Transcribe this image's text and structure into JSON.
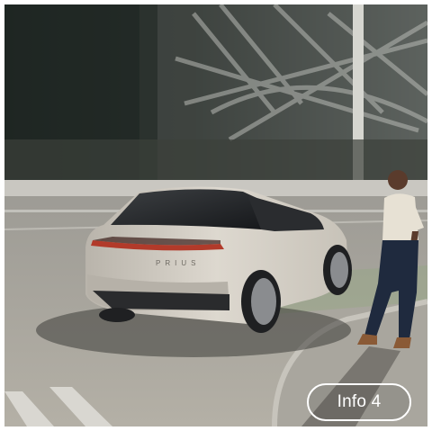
{
  "photo": {
    "subject": "vehicle-photo",
    "car_badge_text": "PRIUS"
  },
  "info_button": {
    "label": "Info 4"
  },
  "colors": {
    "button_border": "#ffffff",
    "button_text": "#ffffff",
    "car_body": "#cfcac2"
  }
}
